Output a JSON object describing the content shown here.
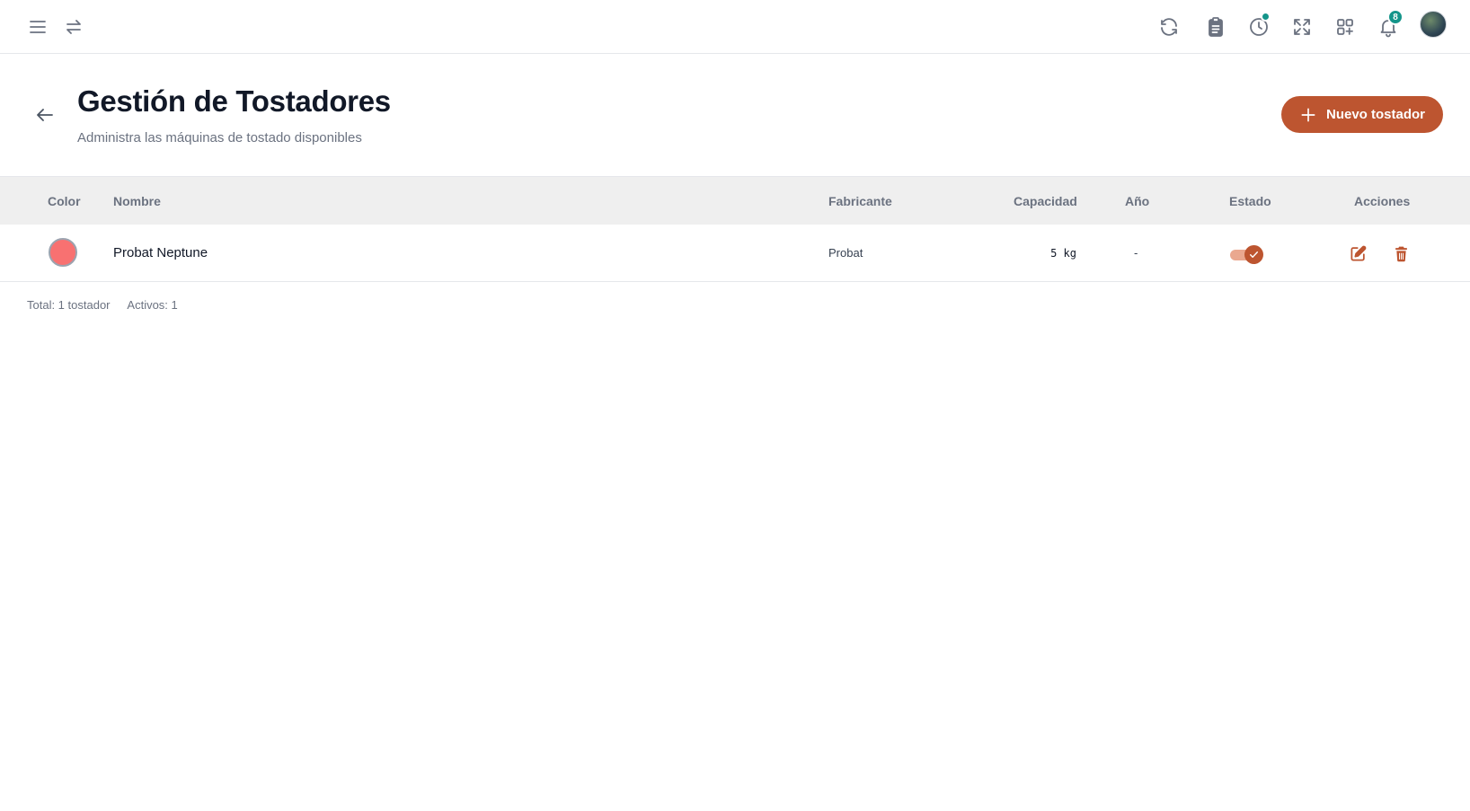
{
  "header": {
    "title": "Gestión de Tostadores",
    "subtitle": "Administra las máquinas de tostado disponibles",
    "new_button_label": "Nuevo tostador",
    "notification_count": "8"
  },
  "topbar": {
    "icons": [
      "menu-icon",
      "swap-icon",
      "refresh-icon",
      "clipboard-icon",
      "clock-icon",
      "fullscreen-icon",
      "apps-icon",
      "bell-icon"
    ]
  },
  "table": {
    "columns": [
      "Color",
      "Nombre",
      "Fabricante",
      "Capacidad",
      "Año",
      "Estado",
      "Acciones"
    ],
    "rows": [
      {
        "color": "#f87171",
        "name": "Probat Neptune",
        "manufacturer": "Probat",
        "capacity": "5 kg",
        "year": "-",
        "active": true
      }
    ]
  },
  "footer": {
    "total": "Total: 1 tostador",
    "active": "Activos: 1"
  },
  "colors": {
    "accent": "#bd5530",
    "teal": "#14958a"
  }
}
